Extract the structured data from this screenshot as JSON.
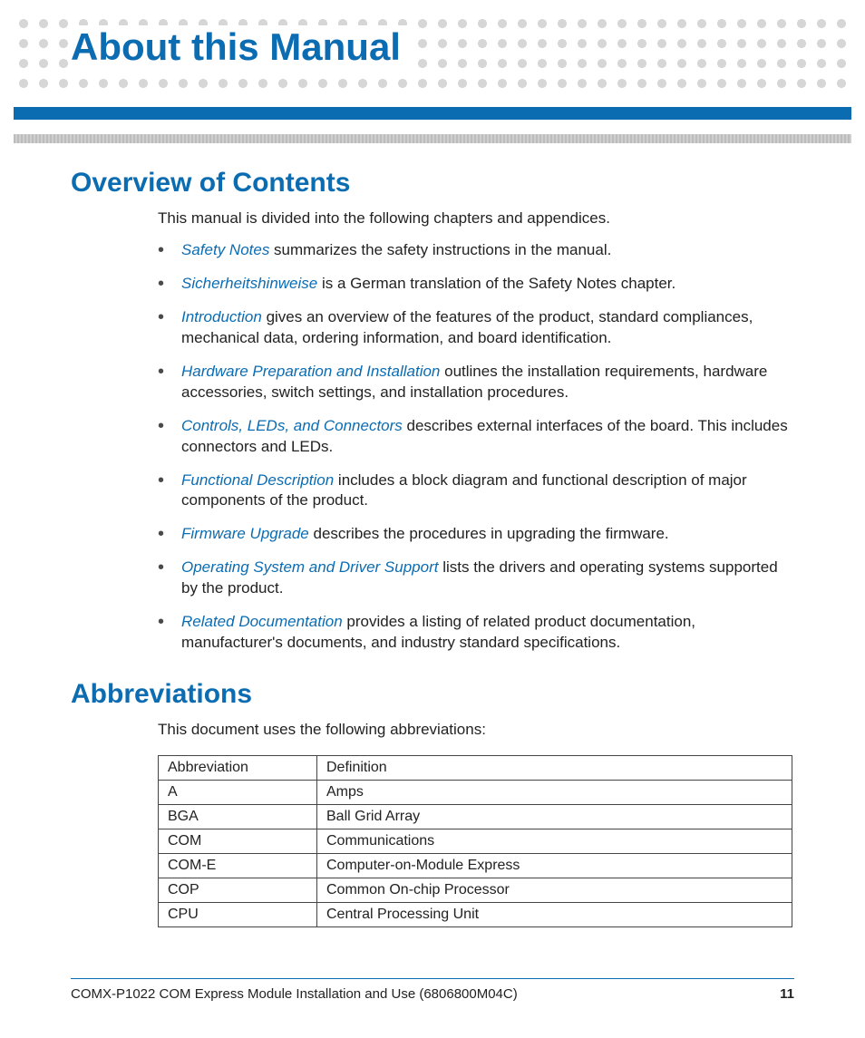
{
  "chapter_title": "About this Manual",
  "sections": {
    "overview": {
      "heading": "Overview of Contents",
      "intro": "This manual is divided into the following chapters and appendices.",
      "items": [
        {
          "link": "Safety Notes",
          "text": " summarizes the safety instructions in the manual."
        },
        {
          "link": "Sicherheitshinweise",
          "text": " is a German translation of the Safety Notes chapter."
        },
        {
          "link": "Introduction",
          "text": " gives an overview of the features of the product, standard compliances, mechanical data, ordering information, and board identification."
        },
        {
          "link": "Hardware Preparation and Installation",
          "text": " outlines the installation requirements, hardware accessories, switch settings, and installation procedures."
        },
        {
          "link": "Controls, LEDs, and Connectors",
          "text": " describes external interfaces of the board. This includes connectors and LEDs."
        },
        {
          "link": "Functional Description",
          "text": " includes a block diagram and functional description of major components of the product."
        },
        {
          "link": "Firmware Upgrade",
          "text": " describes the procedures in upgrading the firmware."
        },
        {
          "link": "Operating System and Driver Support",
          "text": " lists the drivers and operating systems supported by the product."
        },
        {
          "link": "Related Documentation",
          "text": " provides a listing of related product documentation, manufacturer's documents, and industry standard specifications."
        }
      ]
    },
    "abbrev": {
      "heading": "Abbreviations",
      "intro": "This document uses the following abbreviations:",
      "headers": {
        "c1": "Abbreviation",
        "c2": "Definition"
      },
      "rows": [
        {
          "abbr": "A",
          "def": "Amps"
        },
        {
          "abbr": "BGA",
          "def": "Ball Grid Array"
        },
        {
          "abbr": "COM",
          "def": "Communications"
        },
        {
          "abbr": "COM-E",
          "def": "Computer-on-Module Express"
        },
        {
          "abbr": "COP",
          "def": "Common On-chip Processor"
        },
        {
          "abbr": "CPU",
          "def": "Central Processing Unit"
        }
      ]
    }
  },
  "footer": {
    "doc": "COMX-P1022 COM Express Module Installation and Use (6806800M04C)",
    "page": "11"
  }
}
